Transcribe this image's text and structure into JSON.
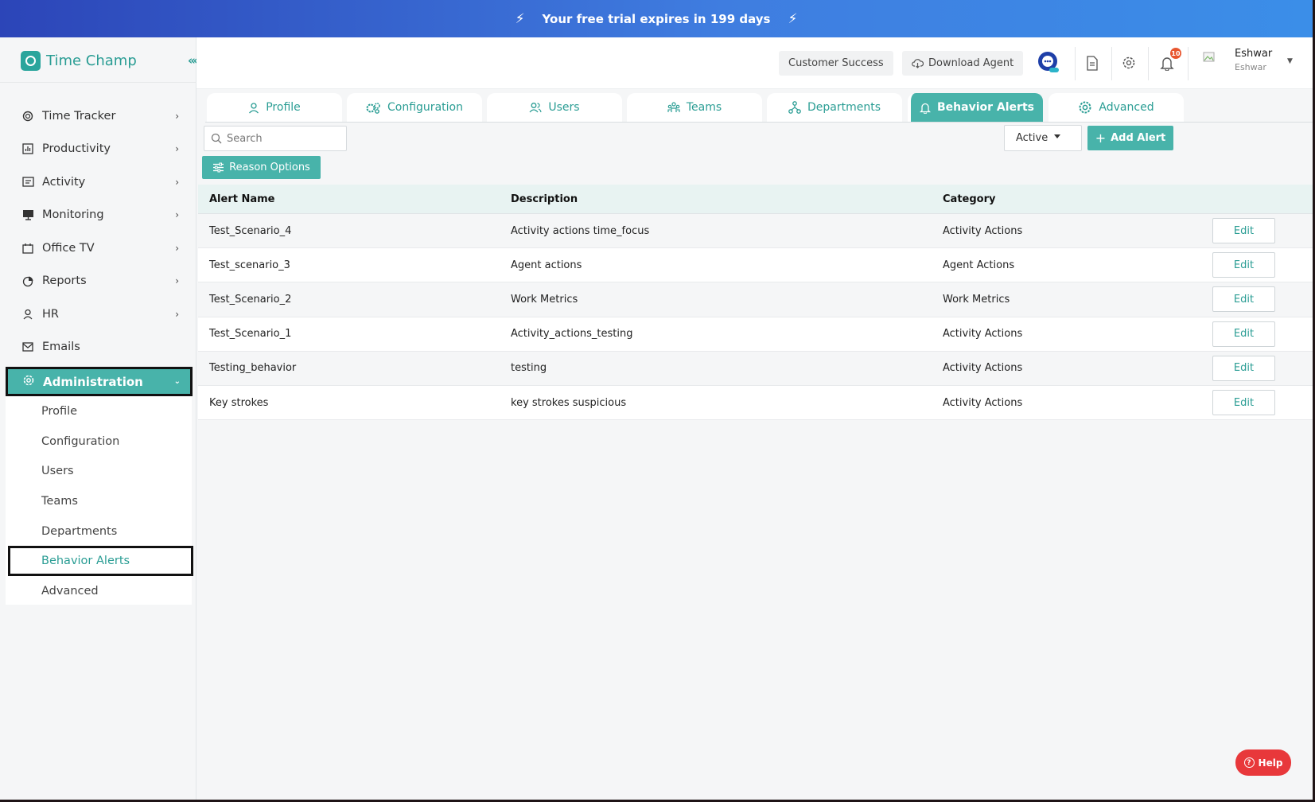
{
  "banner": {
    "text": "Your free trial expires in 199 days"
  },
  "app": {
    "name": "Time Champ"
  },
  "sidebar": {
    "items": [
      {
        "label": "Time Tracker",
        "icon": "clock-icon"
      },
      {
        "label": "Productivity",
        "icon": "bar-chart-icon"
      },
      {
        "label": "Activity",
        "icon": "activity-icon"
      },
      {
        "label": "Monitoring",
        "icon": "monitor-icon"
      },
      {
        "label": "Office TV",
        "icon": "tv-icon"
      },
      {
        "label": "Reports",
        "icon": "pie-chart-icon"
      },
      {
        "label": "HR",
        "icon": "person-icon"
      },
      {
        "label": "Emails",
        "icon": "mail-icon"
      }
    ],
    "admin_label": "Administration",
    "sub_items": [
      "Profile",
      "Configuration",
      "Users",
      "Teams",
      "Departments",
      "Behavior Alerts",
      "Advanced"
    ]
  },
  "header": {
    "customer_success": "Customer Success",
    "download_agent": "Download Agent",
    "notification_count": "10",
    "user_name": "Eshwar",
    "user_sub": "Eshwar"
  },
  "tabs": [
    "Profile",
    "Configuration",
    "Users",
    "Teams",
    "Departments",
    "Behavior Alerts",
    "Advanced"
  ],
  "controls": {
    "search_placeholder": "Search",
    "status_value": "Active",
    "add_alert": "Add Alert",
    "reason_options": "Reason Options"
  },
  "table": {
    "headers": [
      "Alert Name",
      "Description",
      "Category"
    ],
    "edit_label": "Edit",
    "rows": [
      {
        "name": "Test_Scenario_4",
        "description": "Activity actions time_focus",
        "category": "Activity Actions"
      },
      {
        "name": "Test_scenario_3",
        "description": "Agent actions",
        "category": "Agent Actions"
      },
      {
        "name": "Test_Scenario_2",
        "description": "Work Metrics",
        "category": "Work Metrics"
      },
      {
        "name": "Test_Scenario_1",
        "description": "Activity_actions_testing",
        "category": "Activity Actions"
      },
      {
        "name": "Testing_behavior",
        "description": "testing",
        "category": "Activity Actions"
      },
      {
        "name": "Key strokes",
        "description": "key strokes suspicious",
        "category": "Activity Actions"
      }
    ]
  },
  "help": {
    "label": "Help"
  },
  "colors": {
    "accent": "#48b3aa",
    "accent_text": "#2a9d94",
    "banner_start": "#2c45b8",
    "banner_end": "#3b8ee8",
    "help": "#e8383b"
  }
}
